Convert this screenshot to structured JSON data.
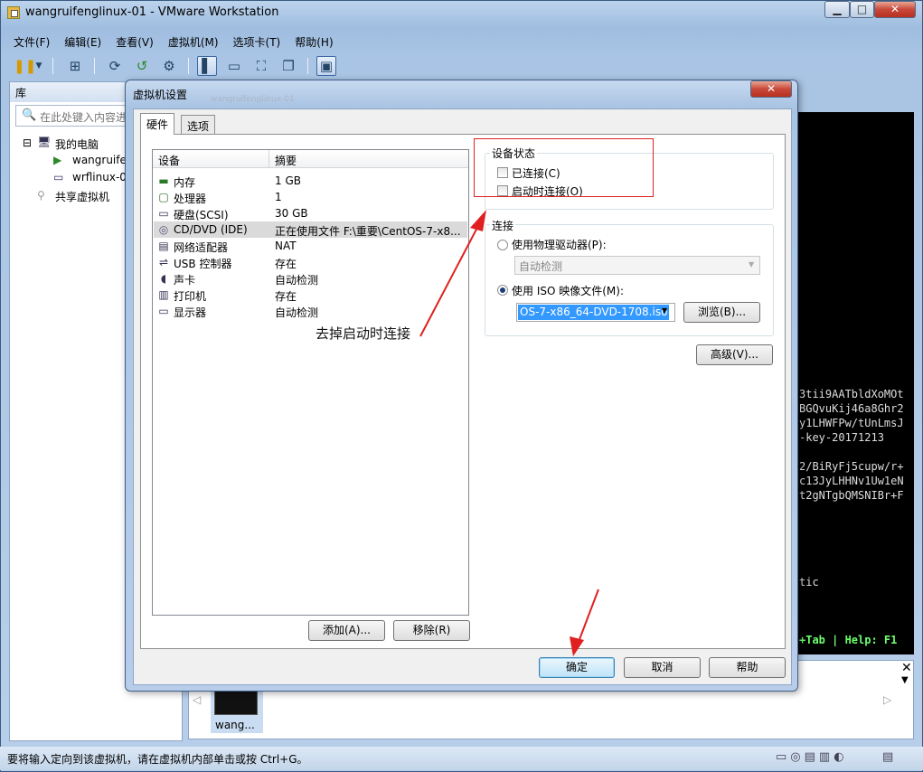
{
  "window": {
    "title": "wangruifenglinux-01 - VMware Workstation",
    "minimize": "▁",
    "maximize": "□",
    "close": "✕"
  },
  "menu": [
    "文件(F)",
    "编辑(E)",
    "查看(V)",
    "虚拟机(M)",
    "选项卡(T)",
    "帮助(H)"
  ],
  "library": {
    "title": "库",
    "search_placeholder": "在此处键入内容进",
    "tree": {
      "root": "我的电脑",
      "vm1": "wangruife",
      "vm2": "wrflinux-0",
      "shared": "共享虚拟机"
    }
  },
  "dialog": {
    "title": "虚拟机设置",
    "close": "✕",
    "bg_tab": "wangruifenglinux-01",
    "tabs": [
      "硬件",
      "选项"
    ],
    "columns": {
      "device": "设备",
      "summary": "摘要"
    },
    "devices": [
      {
        "icon": "memory-icon",
        "name": "内存",
        "summary": "1 GB"
      },
      {
        "icon": "cpu-icon",
        "name": "处理器",
        "summary": "1"
      },
      {
        "icon": "harddisk-icon",
        "name": "硬盘(SCSI)",
        "summary": "30 GB"
      },
      {
        "icon": "cd-icon",
        "name": "CD/DVD (IDE)",
        "summary": "正在使用文件 F:\\重要\\CentOS-7-x8..."
      },
      {
        "icon": "network-icon",
        "name": "网络适配器",
        "summary": "NAT"
      },
      {
        "icon": "usb-icon",
        "name": "USB 控制器",
        "summary": "存在"
      },
      {
        "icon": "sound-icon",
        "name": "声卡",
        "summary": "自动检测"
      },
      {
        "icon": "printer-icon",
        "name": "打印机",
        "summary": "存在"
      },
      {
        "icon": "display-icon",
        "name": "显示器",
        "summary": "自动检测"
      }
    ],
    "selected_index": 3,
    "add_button": "添加(A)...",
    "remove_button": "移除(R)",
    "device_status": {
      "label": "设备状态",
      "connected": "已连接(C)",
      "connect_on_start": "启动时连接(O)",
      "connected_checked": false,
      "connect_on_start_checked": false
    },
    "connection": {
      "label": "连接",
      "physical": "使用物理驱动器(P):",
      "physical_value": "自动检测",
      "iso": "使用 ISO 映像文件(M):",
      "iso_value": "OS-7-x86_64-DVD-1708.iso",
      "browse": "浏览(B)...",
      "selected": "iso"
    },
    "advanced_button": "高级(V)...",
    "ok": "确定",
    "cancel": "取消",
    "help": "帮助"
  },
  "annotation": "去掉启动时连接",
  "terminal_lines": [
    "3tii9AATbldXoMOt",
    "BGQvuKij46a8Ghr2",
    "y1LHWFPw/tUnLmsJ",
    "-key-20171213",
    "",
    "2/BiRyFj5cupw/r+",
    "c13JyLHHNv1Uw1eN",
    "t2gNTgbQMSNIBr+F"
  ],
  "terminal_tic": "tic",
  "terminal_help": "+Tab | Help: F1",
  "thumbnail_label": "wang...",
  "status_text": "要将输入定向到该虚拟机，请在虚拟机内部单击或按 Ctrl+G。",
  "colors": {
    "accent": "#3c7fb1",
    "annotation_red": "#e02020",
    "terminal_green": "#6cff6c"
  }
}
